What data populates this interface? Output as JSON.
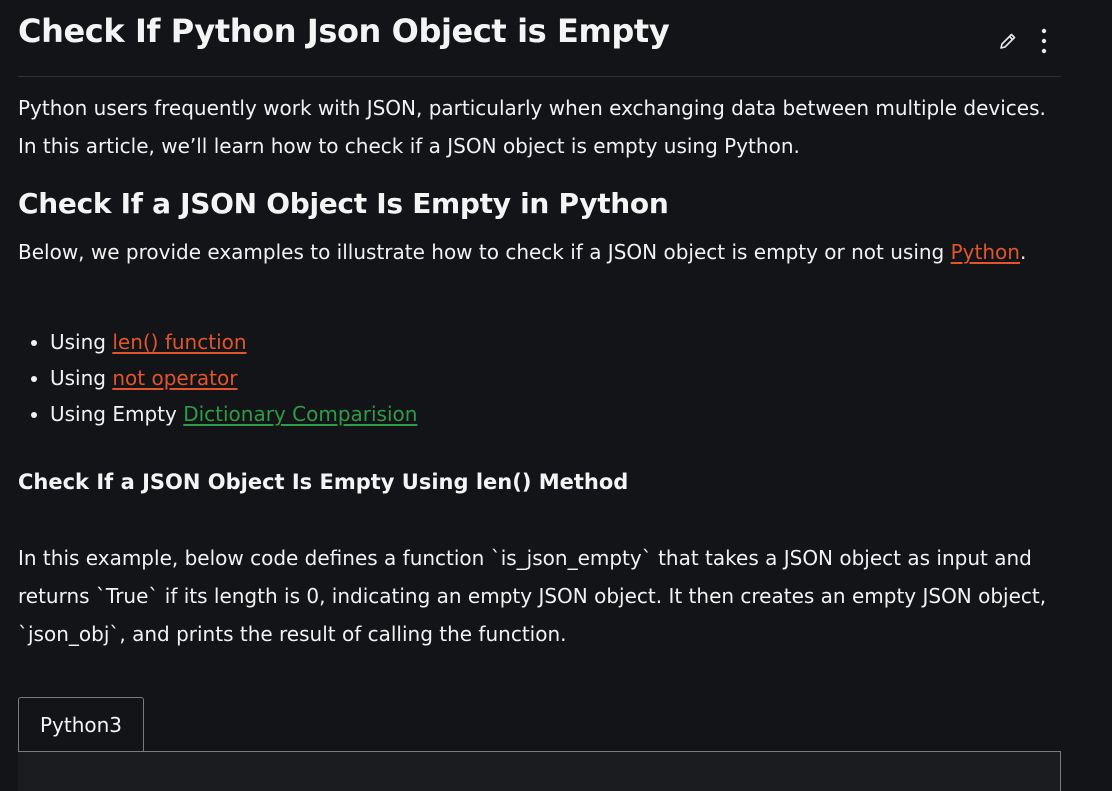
{
  "article": {
    "title": "Check If Python Json Object is Empty",
    "actions": {
      "edit_icon": "pencil-icon",
      "more_icon": "vertical-dots-icon"
    },
    "intro": "Python users frequently work with JSON, particularly when exchanging data between multiple devices. In this article, we’ll learn how to check if a JSON object is empty using Python.",
    "section_heading": "Check If a JSON Object Is Empty in Python",
    "below_text": "Below, we provide examples to illustrate how to check if a JSON object is empty or not using ",
    "below_link": "Python",
    "below_end": ".",
    "methods": [
      {
        "prefix": "Using ",
        "link": "len() function"
      },
      {
        "prefix": "Using ",
        "link": "not operator"
      },
      {
        "prefix": "Using Empty ",
        "link": "Dictionary Comparision"
      }
    ],
    "subheading": "Check If a JSON Object Is Empty Using len() Method",
    "example_text": "In this example, below code defines a function `is_json_empty` that takes a JSON object as input and returns `True` if its length is 0, indicating an empty JSON object. It then creates an empty JSON object, `json_obj`, and prints the result of calling the function.",
    "code_tab": "Python3"
  },
  "colors": {
    "background": "#131417",
    "text": "#f2f2f2",
    "link_orange": "#e0552c",
    "link_green": "#2f9a48",
    "divider": "#2e3036",
    "tab_border": "#7a7c80"
  }
}
